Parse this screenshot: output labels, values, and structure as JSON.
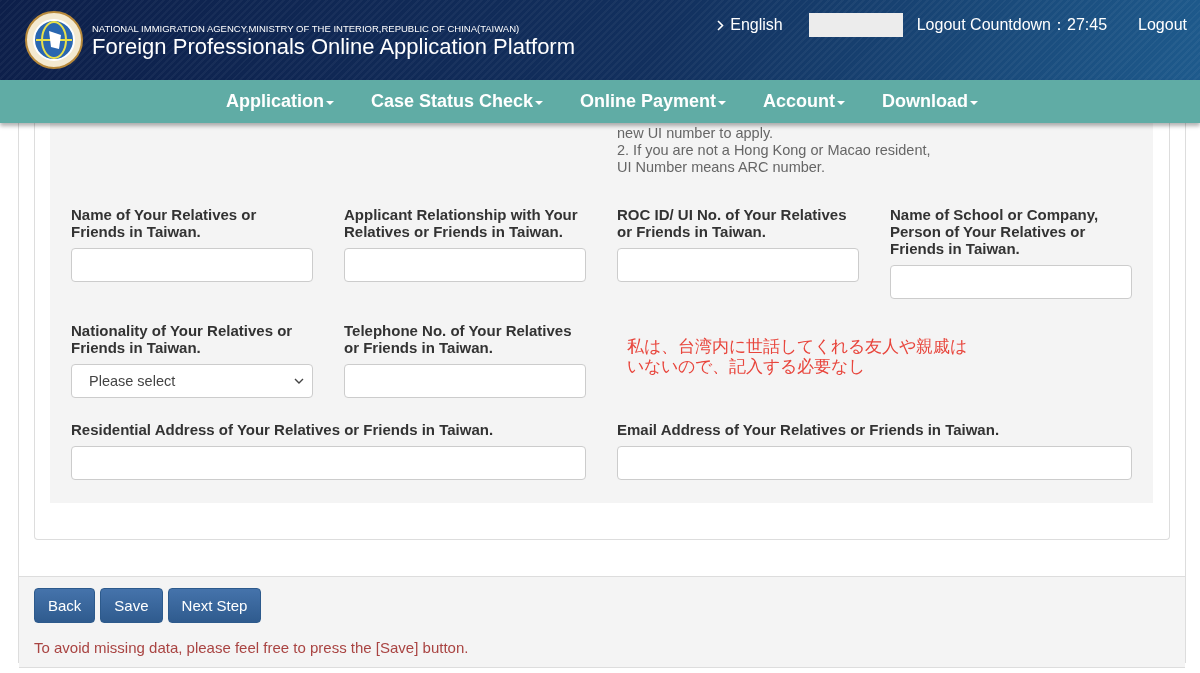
{
  "header": {
    "agency": "NATIONAL IMMIGRATION AGENCY,MINISTRY OF THE INTERIOR,REPUBLIC OF CHINA(TAIWAN)",
    "title": "Foreign Professionals Online Application Platform",
    "language": "English",
    "countdown": "Logout Countdown：27:45",
    "logout": "Logout"
  },
  "nav": [
    {
      "label": "Application"
    },
    {
      "label": "Case Status Check"
    },
    {
      "label": "Online Payment"
    },
    {
      "label": "Account"
    },
    {
      "label": "Download"
    }
  ],
  "notes": [
    "new UI number to apply.",
    "2. If you are not a Hong Kong or Macao resident,",
    "UI Number means ARC number."
  ],
  "fields": [
    {
      "kind": "text",
      "label": "Name of Your Relatives or Friends in Taiwan."
    },
    {
      "kind": "text",
      "label": "Applicant Relationship with Your Relatives or Friends in Taiwan."
    },
    {
      "kind": "text",
      "label": "ROC ID/ UI No. of Your Relatives or Friends in Taiwan."
    },
    {
      "kind": "text",
      "label": "Name of School or Company, Person of Your Relatives or Friends in Taiwan."
    },
    {
      "kind": "select",
      "label": "Nationality of Your Relatives or Friends in Taiwan.",
      "placeholder": "Please select"
    },
    {
      "kind": "text",
      "label": "Telephone No. of Your Relatives or Friends in Taiwan."
    },
    {
      "kind": "annotation",
      "lines": [
        "私は、台湾内に世話してくれる友人や親戚は",
        "いないので、記入する必要なし"
      ]
    },
    {
      "kind": "wide",
      "label": "Residential Address of Your Relatives or Friends in Taiwan."
    },
    {
      "kind": "wide",
      "label": "Email Address of Your Relatives or Friends in Taiwan."
    }
  ],
  "buttons": [
    "Back",
    "Save",
    "Next Step"
  ],
  "footer_note": "To avoid missing data, please feel free to press the [Save] button."
}
